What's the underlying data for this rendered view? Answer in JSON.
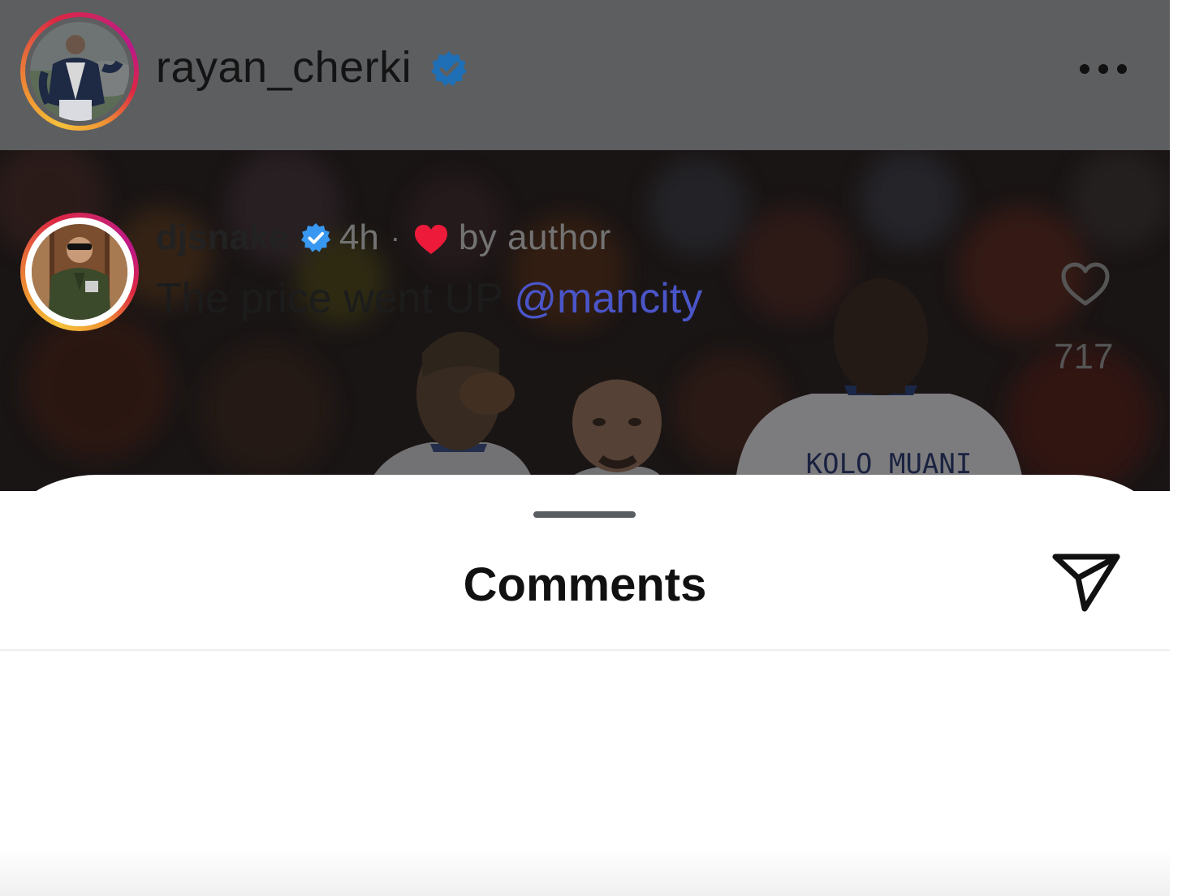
{
  "post": {
    "username": "rayan_cherki",
    "verified": true,
    "more_icon": "more-horizontal-icon",
    "photo_jersey_text": "KOLO MUANI"
  },
  "comments_sheet": {
    "title": "Comments",
    "share_icon": "send-paper-plane-icon"
  },
  "comments": [
    {
      "username": "djsnake",
      "verified": true,
      "time": "4h",
      "separator": "·",
      "liked_by_author_label": "by author",
      "text_prefix": "The price went UP ",
      "mention": "@mancity",
      "like_count": "717"
    }
  ],
  "colors": {
    "verified_blue": "#3897f0",
    "mention_blue": "#4a55c8",
    "heart_red": "#ed1a3a",
    "dim_overlay": "#5d5e60"
  }
}
